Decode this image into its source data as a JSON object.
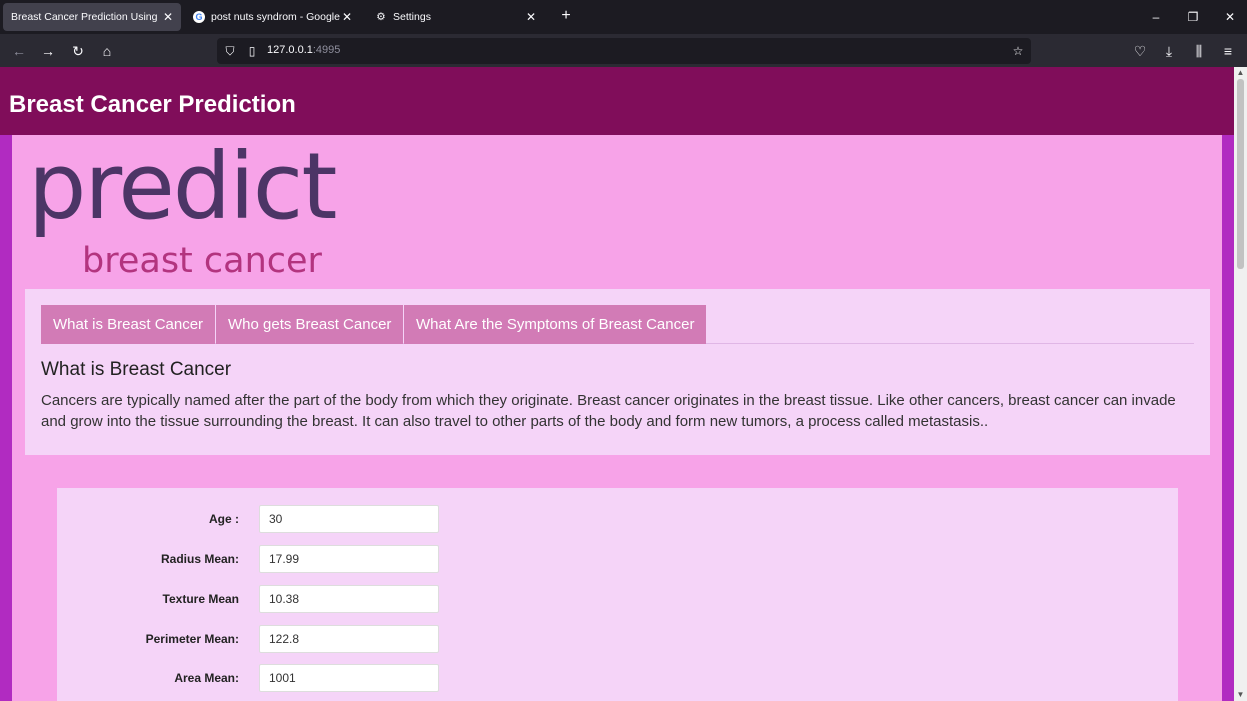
{
  "browser": {
    "tabs": [
      {
        "title": "Breast Cancer Prediction Using Mac",
        "active": true
      },
      {
        "title": "post nuts syndrom - Google Se",
        "active": false
      },
      {
        "title": "Settings",
        "active": false
      }
    ],
    "url_host": "127.0.0.1",
    "url_port": ":4995",
    "new_tab_icon": "+"
  },
  "site": {
    "title": "Breast Cancer Prediction",
    "logo_word": "predict",
    "logo_subtitle": "breast cancer"
  },
  "info": {
    "tabs": [
      "What is Breast Cancer",
      "Who gets Breast Cancer",
      "What Are the Symptoms of Breast Cancer"
    ],
    "heading": "What is Breast Cancer",
    "text": "Cancers are typically named after the part of the body from which they originate. Breast cancer originates in the breast tissue. Like other cancers, breast cancer can invade and grow into the tissue surrounding the breast. It can also travel to other parts of the body and form new tumors, a process called metastasis.."
  },
  "form": {
    "fields": [
      {
        "label": "Age :",
        "value": "30"
      },
      {
        "label": "Radius Mean:",
        "value": "17.99"
      },
      {
        "label": "Texture Mean",
        "value": "10.38"
      },
      {
        "label": "Perimeter Mean:",
        "value": "122.8"
      },
      {
        "label": "Area Mean:",
        "value": "1001"
      }
    ]
  }
}
